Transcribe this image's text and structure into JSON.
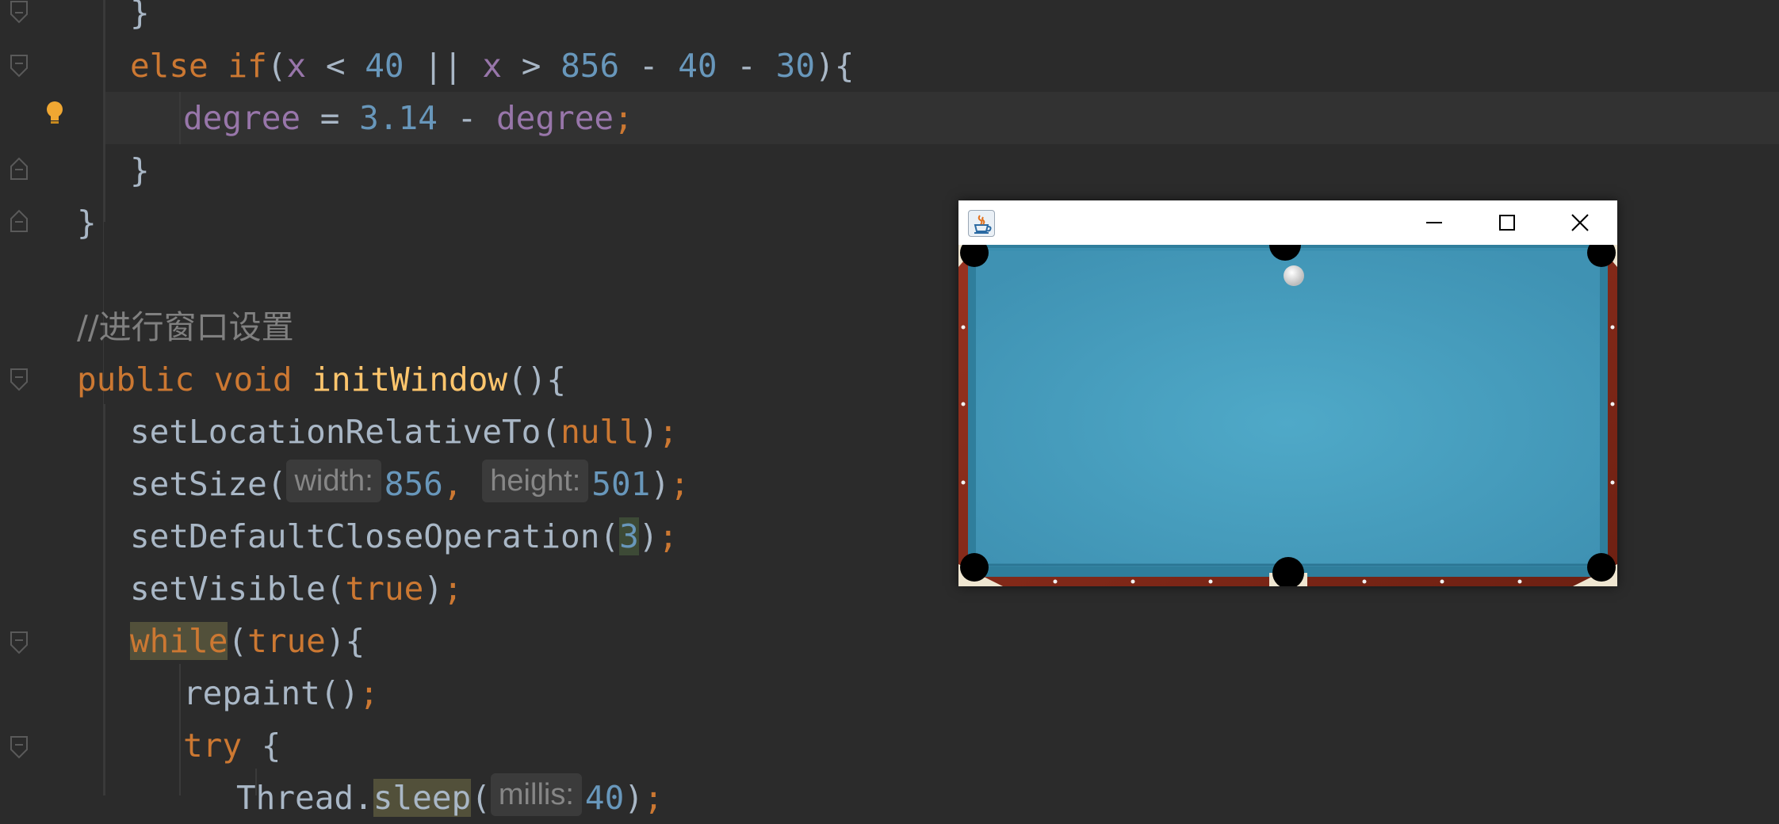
{
  "editor": {
    "lines": [
      {
        "tokens": [
          {
            "t": "}",
            "c": "pu"
          }
        ]
      },
      {
        "tokens": [
          {
            "t": "else if",
            "c": "kw"
          },
          {
            "t": "(",
            "c": "pu"
          },
          {
            "t": "x",
            "c": "var"
          },
          {
            "t": " < ",
            "c": "pu"
          },
          {
            "t": "40",
            "c": "num"
          },
          {
            "t": " || ",
            "c": "pu"
          },
          {
            "t": "x",
            "c": "var"
          },
          {
            "t": " > ",
            "c": "pu"
          },
          {
            "t": "856",
            "c": "num"
          },
          {
            "t": " - ",
            "c": "pu"
          },
          {
            "t": "40",
            "c": "num"
          },
          {
            "t": " - ",
            "c": "pu"
          },
          {
            "t": "30",
            "c": "num"
          },
          {
            "t": "){",
            "c": "pu"
          }
        ]
      },
      {
        "tokens": [
          {
            "t": "degree",
            "c": "var"
          },
          {
            "t": " = ",
            "c": "pu"
          },
          {
            "t": "3.14",
            "c": "num"
          },
          {
            "t": " - ",
            "c": "pu"
          },
          {
            "t": "degree",
            "c": "var"
          },
          {
            "t": ";",
            "c": "kw"
          }
        ]
      },
      {
        "tokens": [
          {
            "t": "}",
            "c": "pu"
          }
        ]
      },
      {
        "tokens": [
          {
            "t": "}",
            "c": "pu"
          }
        ]
      },
      {
        "tokens": []
      },
      {
        "tokens": [
          {
            "t": "//进行窗口设置",
            "c": "cm"
          }
        ]
      },
      {
        "tokens": [
          {
            "t": "public void ",
            "c": "kw"
          },
          {
            "t": "initWindow",
            "c": "fn"
          },
          {
            "t": "(){",
            "c": "pu"
          }
        ]
      },
      {
        "tokens": [
          {
            "t": "setLocationRelativeTo(",
            "c": "pu"
          },
          {
            "t": "null",
            "c": "kw"
          },
          {
            "t": ")",
            "c": "pu"
          },
          {
            "t": ";",
            "c": "kw"
          }
        ]
      },
      {
        "tokens": [
          {
            "t": "setSize(",
            "c": "pu"
          },
          {
            "t": "width:",
            "c": "hint"
          },
          {
            "t": "856",
            "c": "num"
          },
          {
            "t": ", ",
            "c": "kw"
          },
          {
            "t": "height:",
            "c": "hint"
          },
          {
            "t": "501",
            "c": "num"
          },
          {
            "t": ")",
            "c": "pu"
          },
          {
            "t": ";",
            "c": "kw"
          }
        ]
      },
      {
        "tokens": [
          {
            "t": "setDefaultCloseOperation(",
            "c": "pu"
          },
          {
            "t": "3",
            "c": "num hl-num"
          },
          {
            "t": ")",
            "c": "pu"
          },
          {
            "t": ";",
            "c": "kw"
          }
        ]
      },
      {
        "tokens": [
          {
            "t": "setVisible(",
            "c": "pu"
          },
          {
            "t": "true",
            "c": "kw"
          },
          {
            "t": ")",
            "c": "pu"
          },
          {
            "t": ";",
            "c": "kw"
          }
        ]
      },
      {
        "tokens": [
          {
            "t": "while",
            "c": "kw hl-box"
          },
          {
            "t": "(",
            "c": "pu"
          },
          {
            "t": "true",
            "c": "kw"
          },
          {
            "t": "){",
            "c": "pu"
          }
        ]
      },
      {
        "tokens": [
          {
            "t": "repaint()",
            "c": "pu"
          },
          {
            "t": ";",
            "c": "kw"
          }
        ]
      },
      {
        "tokens": [
          {
            "t": "try ",
            "c": "kw"
          },
          {
            "t": "{",
            "c": "pu"
          }
        ]
      },
      {
        "tokens": [
          {
            "t": "Thread.",
            "c": "pu"
          },
          {
            "t": "sleep",
            "c": "pu hl-box"
          },
          {
            "t": "(",
            "c": "pu"
          },
          {
            "t": "millis:",
            "c": "hint"
          },
          {
            "t": "40",
            "c": "num"
          },
          {
            "t": ")",
            "c": "pu"
          },
          {
            "t": ";",
            "c": "kw"
          }
        ]
      }
    ]
  },
  "window": {
    "title": "",
    "icon": "java-coffee-icon",
    "buttons": [
      "minimize-icon",
      "maximize-icon",
      "close-icon"
    ]
  },
  "game": {
    "felt_color": "#4aa3c4",
    "rail_color": "#8a2c1a",
    "pocket_color": "#000000",
    "ball_color": "#e6e6e6"
  }
}
